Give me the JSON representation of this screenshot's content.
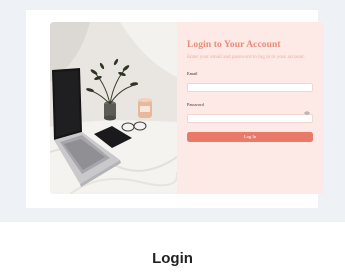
{
  "login_card": {
    "title": "Login to Your Account",
    "subtitle": "Enter your email and password to log in to your account.",
    "email_label": "Email",
    "email_value": "",
    "password_label": "Password",
    "password_value": "",
    "submit_label": "Log In",
    "show_password_icon": "eye-icon"
  },
  "caption": {
    "title": "Login"
  },
  "colors": {
    "accent": "#e97a6a",
    "title": "#e88a7a",
    "card_background": "#fdeae6",
    "preview_background": "#eef1f6"
  }
}
